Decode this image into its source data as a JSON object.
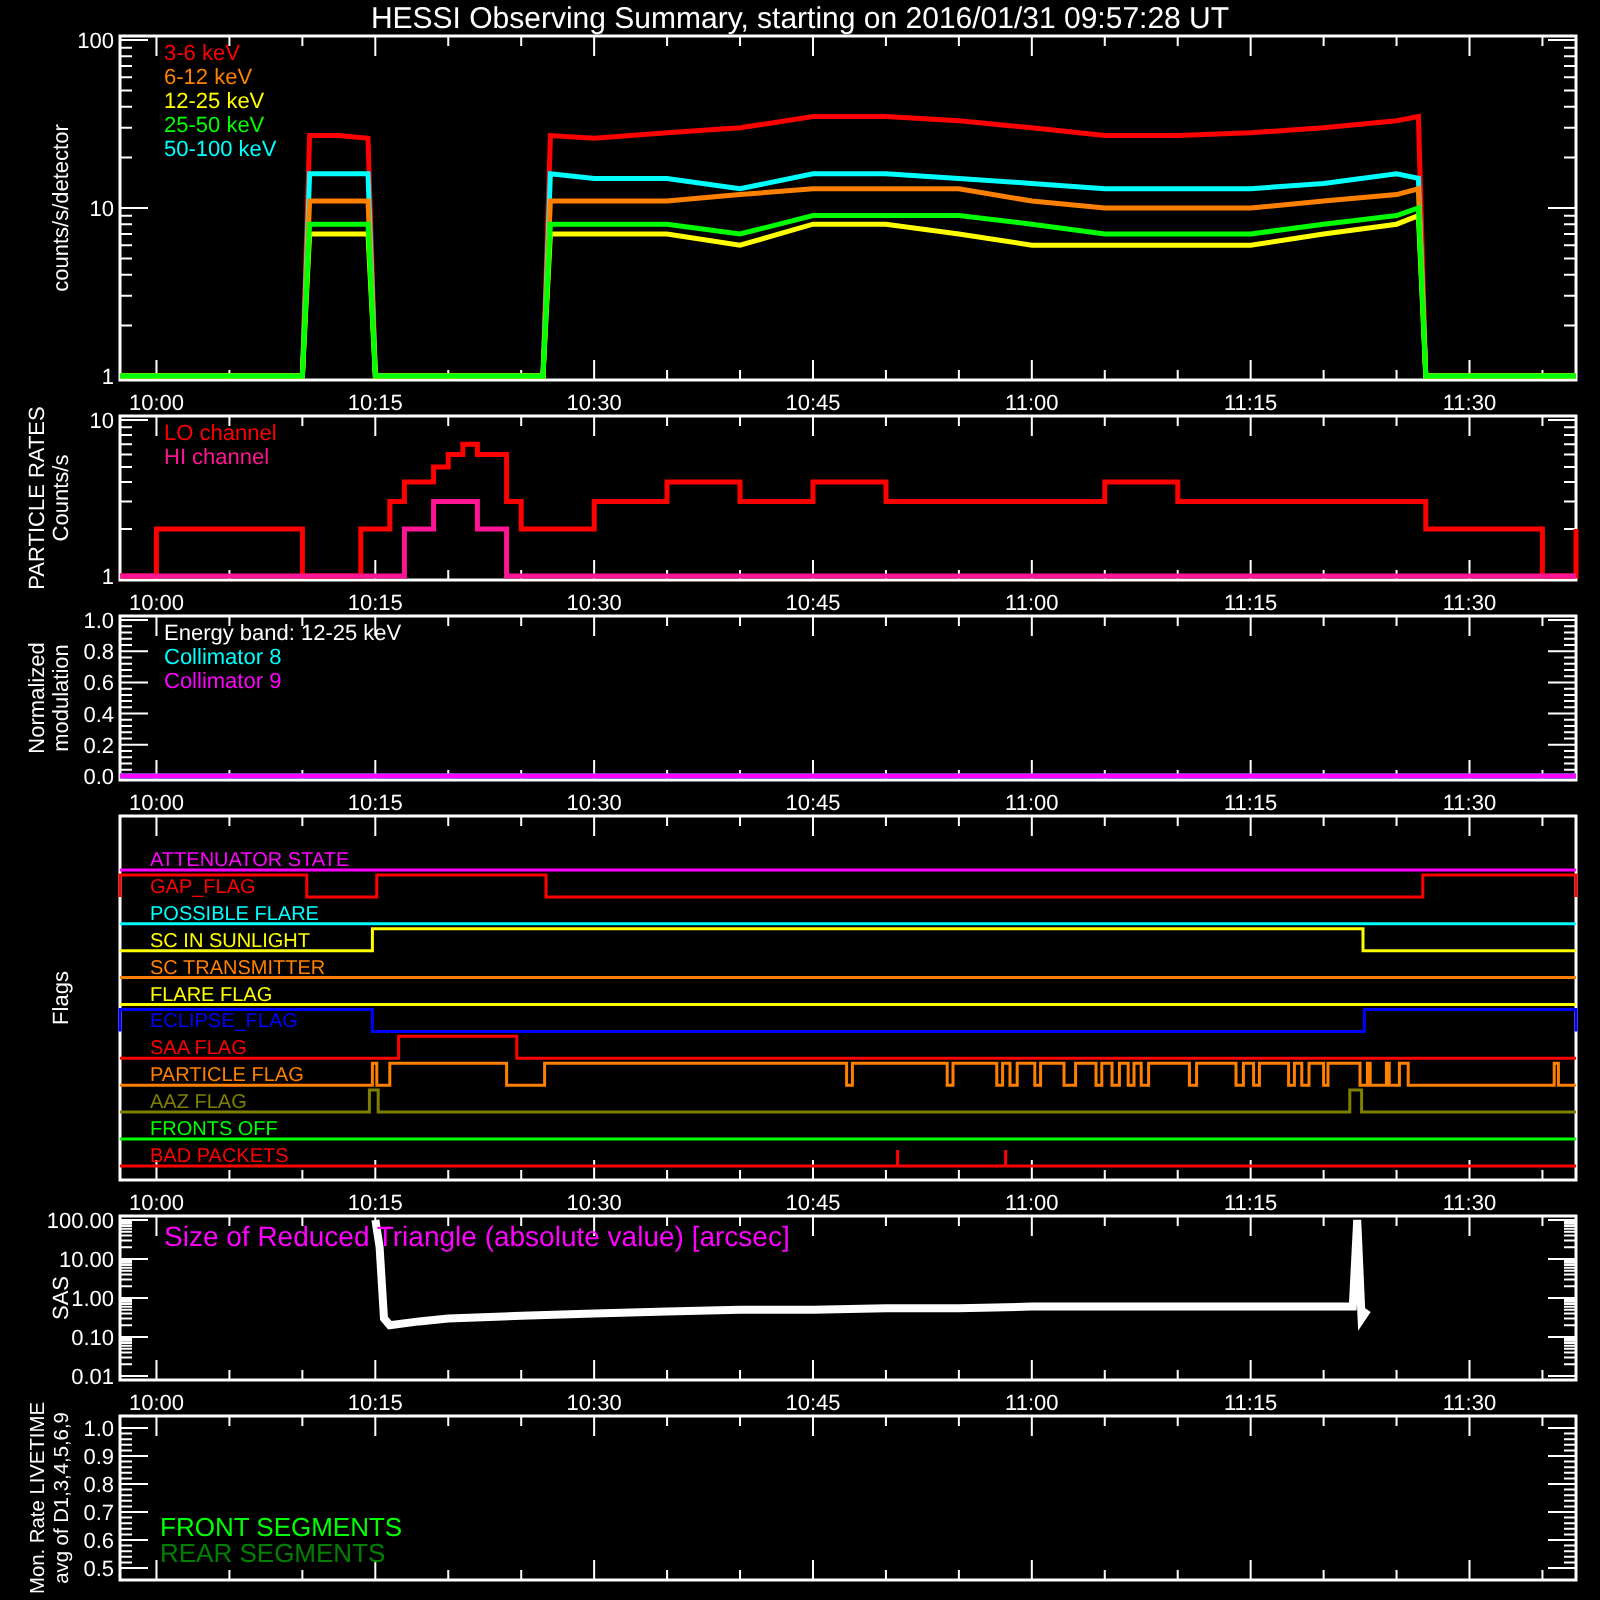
{
  "title": "HESSI Observing Summary, starting on 2016/01/31 09:57:28 UT",
  "panels": [
    {
      "kind": "plot",
      "ylabel": "counts/s/detector",
      "yticks": [
        "100",
        "10",
        "1"
      ],
      "xticks": [
        "10:00",
        "10:15",
        "10:30",
        "10:45",
        "11:00",
        "11:15",
        "11:30"
      ],
      "legend": [
        {
          "name": "3-6 keV",
          "color": "#ff0000"
        },
        {
          "name": "6-12 keV",
          "color": "#ff8000"
        },
        {
          "name": "12-25 keV",
          "color": "#ffff00"
        },
        {
          "name": "25-50 keV",
          "color": "#00ff00"
        },
        {
          "name": "50-100 keV",
          "color": "#00ffff"
        }
      ]
    },
    {
      "kind": "plot",
      "ylabel": [
        "PARTICLE RATES",
        "Counts/s"
      ],
      "yticks": [
        "10",
        "1"
      ],
      "xticks": [
        "10:00",
        "10:15",
        "10:30",
        "10:45",
        "11:00",
        "11:15",
        "11:30"
      ],
      "legend": [
        {
          "name": "LO channel",
          "color": "#ff0000"
        },
        {
          "name": "HI channel",
          "color": "#ff1493"
        }
      ]
    },
    {
      "kind": "plot",
      "ylabel": [
        "Normalized",
        "modulation"
      ],
      "yticks": [
        "1.0",
        "0.8",
        "0.6",
        "0.4",
        "0.2",
        "0.0"
      ],
      "xticks": [
        "10:00",
        "10:15",
        "10:30",
        "10:45",
        "11:00",
        "11:15",
        "11:30"
      ],
      "note": "Energy band: 12-25 keV",
      "legend": [
        {
          "name": "Collimator 8",
          "color": "#00ffff"
        },
        {
          "name": "Collimator 9",
          "color": "#ff00ff"
        }
      ]
    },
    {
      "kind": "flags",
      "ylabel": "Flags",
      "xticks": [
        "10:00",
        "10:15",
        "10:30",
        "10:45",
        "11:00",
        "11:15",
        "11:30"
      ],
      "flags": [
        {
          "label": "ATTENUATOR STATE",
          "color": "#ff00ff"
        },
        {
          "label": "GAP_FLAG",
          "color": "#ff0000"
        },
        {
          "label": "POSSIBLE FLARE",
          "color": "#00ffff"
        },
        {
          "label": "SC IN SUNLIGHT",
          "color": "#ffff00"
        },
        {
          "label": "SC TRANSMITTER",
          "color": "#ff8000"
        },
        {
          "label": "FLARE FLAG",
          "color": "#ffff00"
        },
        {
          "label": "ECLIPSE_FLAG",
          "color": "#0000ff"
        },
        {
          "label": "SAA FLAG",
          "color": "#ff0000"
        },
        {
          "label": "PARTICLE FLAG",
          "color": "#ff8000"
        },
        {
          "label": "AAZ FLAG",
          "color": "#808000"
        },
        {
          "label": "FRONTS OFF",
          "color": "#00ff00"
        },
        {
          "label": "BAD PACKETS",
          "color": "#ff0000"
        }
      ]
    },
    {
      "kind": "plot",
      "ylabel": "SAS",
      "yticks": [
        "100.00",
        "10.00",
        "1.00",
        "0.10",
        "0.01"
      ],
      "xticks": [
        "10:00",
        "10:15",
        "10:30",
        "10:45",
        "11:00",
        "11:15",
        "11:30"
      ],
      "title": "Size of Reduced Triangle (absolute value) [arcsec]"
    },
    {
      "kind": "plot",
      "ylabel": [
        "Mon. Rate LIVETIME",
        "avg of D1,3,4,5,6,9"
      ],
      "yticks": [
        "1.0",
        "0.9",
        "0.8",
        "0.7",
        "0.6",
        "0.5"
      ],
      "legend": [
        {
          "name": "FRONT SEGMENTS",
          "color": "#00ff00"
        },
        {
          "name": "REAR SEGMENTS",
          "color": "#008000"
        }
      ]
    }
  ]
}
